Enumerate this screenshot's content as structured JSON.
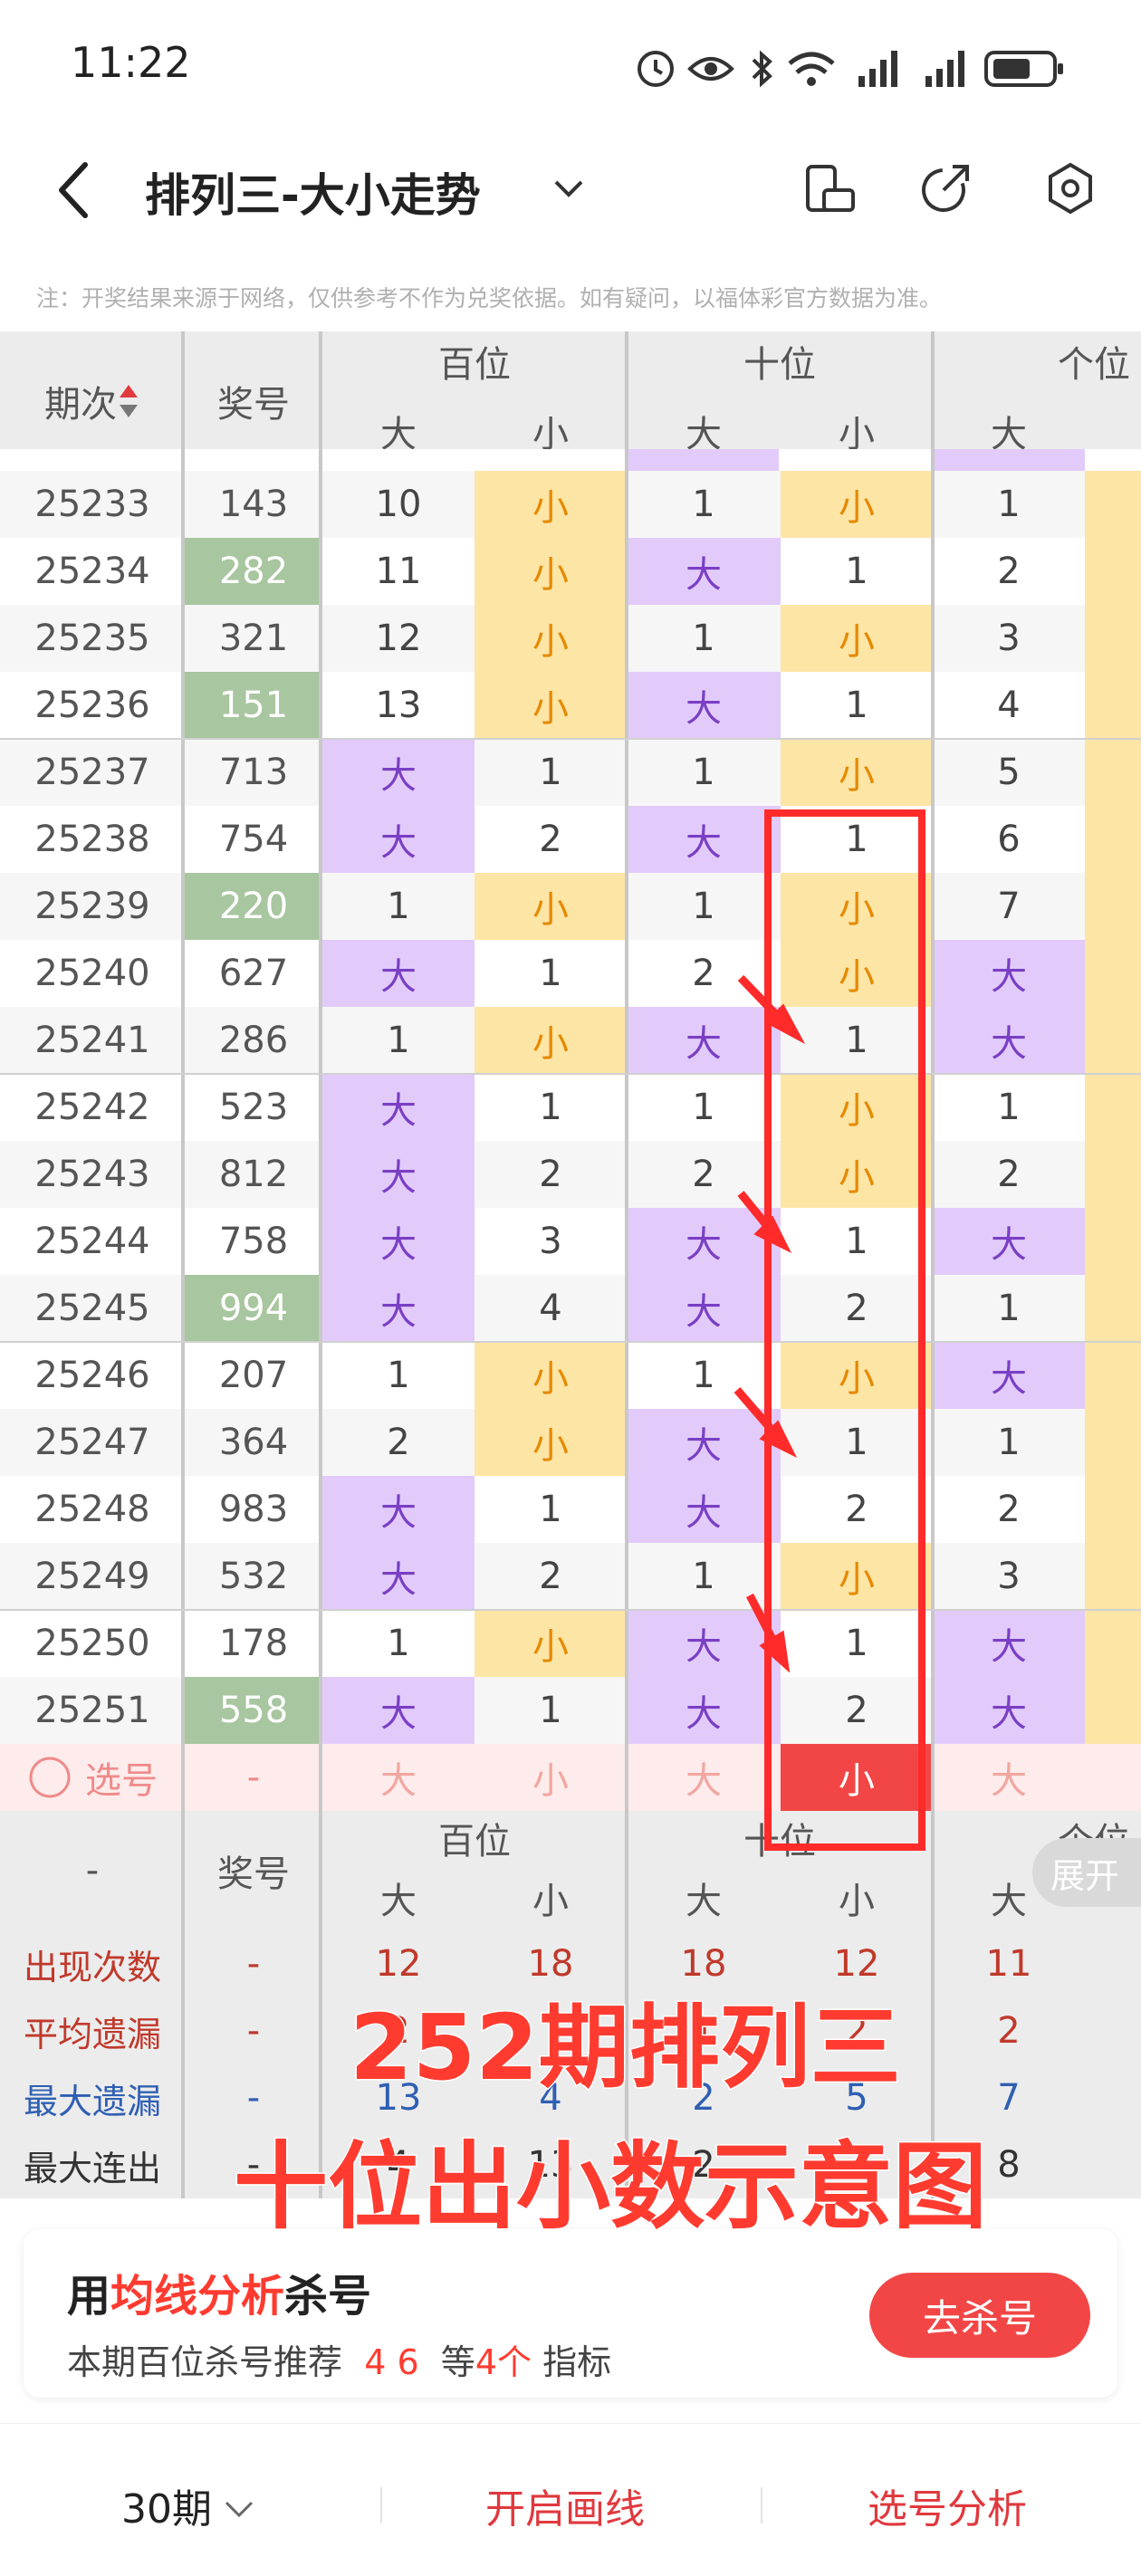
{
  "status_bar": {
    "time": "11:22"
  },
  "header": {
    "title": "排列三-大小走势"
  },
  "notice": "注：开奖结果来源于网络，仅供参考不作为兑奖依据。如有疑问，以福体彩官方数据为准。",
  "table": {
    "col_period": "期次",
    "col_number": "奖号",
    "groups": [
      "百位",
      "十位",
      "个位"
    ],
    "sub": [
      "大",
      "小"
    ],
    "rows": [
      {
        "period": "25233",
        "number": "143",
        "hi": false,
        "cells": [
          "10",
          "小",
          "1",
          "小",
          "1"
        ]
      },
      {
        "period": "25234",
        "number": "282",
        "hi": true,
        "cells": [
          "11",
          "小",
          "大",
          "1",
          "2"
        ]
      },
      {
        "period": "25235",
        "number": "321",
        "hi": false,
        "cells": [
          "12",
          "小",
          "1",
          "小",
          "3"
        ]
      },
      {
        "period": "25236",
        "number": "151",
        "hi": true,
        "cells": [
          "13",
          "小",
          "大",
          "1",
          "4"
        ]
      },
      {
        "period": "25237",
        "number": "713",
        "hi": false,
        "cells": [
          "大",
          "1",
          "1",
          "小",
          "5"
        ]
      },
      {
        "period": "25238",
        "number": "754",
        "hi": false,
        "cells": [
          "大",
          "2",
          "大",
          "1",
          "6"
        ]
      },
      {
        "period": "25239",
        "number": "220",
        "hi": true,
        "cells": [
          "1",
          "小",
          "1",
          "小",
          "7"
        ]
      },
      {
        "period": "25240",
        "number": "627",
        "hi": false,
        "cells": [
          "大",
          "1",
          "2",
          "小",
          "大"
        ]
      },
      {
        "period": "25241",
        "number": "286",
        "hi": false,
        "cells": [
          "1",
          "小",
          "大",
          "1",
          "大"
        ]
      },
      {
        "period": "25242",
        "number": "523",
        "hi": false,
        "cells": [
          "大",
          "1",
          "1",
          "小",
          "1"
        ]
      },
      {
        "period": "25243",
        "number": "812",
        "hi": false,
        "cells": [
          "大",
          "2",
          "2",
          "小",
          "2"
        ]
      },
      {
        "period": "25244",
        "number": "758",
        "hi": false,
        "cells": [
          "大",
          "3",
          "大",
          "1",
          "大"
        ]
      },
      {
        "period": "25245",
        "number": "994",
        "hi": true,
        "cells": [
          "大",
          "4",
          "大",
          "2",
          "1"
        ]
      },
      {
        "period": "25246",
        "number": "207",
        "hi": false,
        "cells": [
          "1",
          "小",
          "1",
          "小",
          "大"
        ]
      },
      {
        "period": "25247",
        "number": "364",
        "hi": false,
        "cells": [
          "2",
          "小",
          "大",
          "1",
          "1"
        ]
      },
      {
        "period": "25248",
        "number": "983",
        "hi": false,
        "cells": [
          "大",
          "1",
          "大",
          "2",
          "2"
        ]
      },
      {
        "period": "25249",
        "number": "532",
        "hi": false,
        "cells": [
          "大",
          "2",
          "1",
          "小",
          "3"
        ]
      },
      {
        "period": "25250",
        "number": "178",
        "hi": false,
        "cells": [
          "1",
          "小",
          "大",
          "1",
          "大"
        ]
      },
      {
        "period": "25251",
        "number": "558",
        "hi": true,
        "cells": [
          "大",
          "1",
          "大",
          "2",
          "大"
        ]
      }
    ],
    "select_row": {
      "label": "选号",
      "number": "-",
      "cells": [
        "大",
        "小",
        "大",
        "小",
        "大"
      ]
    },
    "stats_header": {
      "col_period": "-",
      "col_number": "奖号"
    },
    "stats": [
      {
        "label": "出现次数",
        "number": "-",
        "color": "#c0392b",
        "cells": [
          "12",
          "18",
          "18",
          "12",
          "11"
        ]
      },
      {
        "label": "平均遗漏",
        "number": "-",
        "color": "#c0392b",
        "cells": [
          "2",
          "",
          "1",
          "2",
          "2"
        ]
      },
      {
        "label": "最大遗漏",
        "number": "-",
        "color": "#2f5fb3",
        "cells": [
          "13",
          "4",
          "2",
          "5",
          "7"
        ]
      },
      {
        "label": "最大连出",
        "number": "-",
        "color": "#333333",
        "cells": [
          "4",
          "13",
          "2",
          "",
          "8"
        ]
      }
    ]
  },
  "overlay": {
    "line1": "252期排列三",
    "line2": "十位出小数示意图"
  },
  "expand_label": "展开",
  "promo": {
    "title_prefix": "用",
    "title_highlight": "均线分析",
    "title_suffix": "杀号",
    "sub_prefix": "本期百位杀号推荐",
    "sub_nums": "4 6",
    "sub_mid": "等",
    "sub_count": "4个",
    "sub_suffix": "指标",
    "button": "去杀号"
  },
  "bottom_bar": {
    "period_select": "30期",
    "draw_line": "开启画线",
    "analysis": "选号分析"
  },
  "colors": {
    "big_bg": "#e2cbfb",
    "small_bg": "#fde5a6",
    "hi_num_bg": "#a8c69f",
    "accent_red": "#ff3b30"
  }
}
